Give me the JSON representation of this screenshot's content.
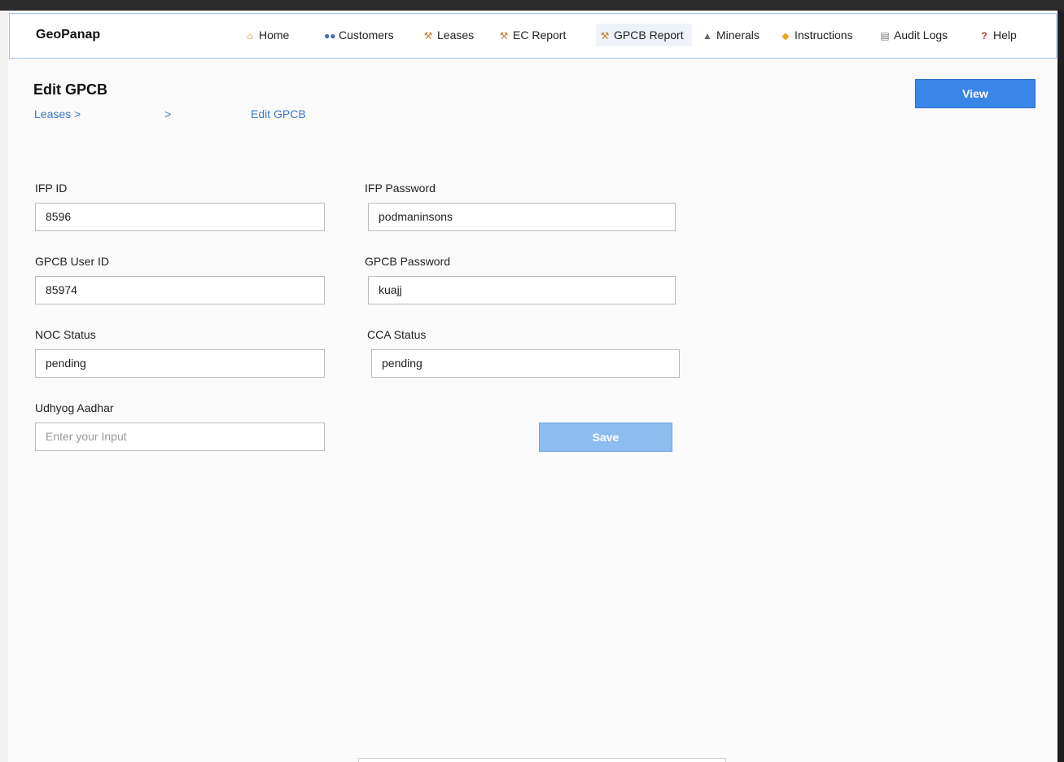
{
  "brand": "GeoPanap",
  "nav": [
    {
      "label": "Home",
      "icon": "home-icon"
    },
    {
      "label": "Customers",
      "icon": "users-icon"
    },
    {
      "label": "Leases",
      "icon": "crane-icon"
    },
    {
      "label": "EC Report",
      "icon": "crane-icon"
    },
    {
      "label": "GPCB Report",
      "icon": "crane-icon"
    },
    {
      "label": "Minerals",
      "icon": "rock-icon"
    },
    {
      "label": "Instructions",
      "icon": "handshake-icon"
    },
    {
      "label": "Audit Logs",
      "icon": "clipboard-icon"
    },
    {
      "label": "Help",
      "icon": "question-icon"
    }
  ],
  "page": {
    "title": "Edit GPCB",
    "breadcrumb": [
      "Leases >",
      ">",
      "Edit GPCB"
    ],
    "view_label": "View"
  },
  "form": {
    "ifp_id_label": "IFP ID",
    "ifp_id_value": "8596",
    "ifp_password_label": "IFP Password",
    "ifp_password_value": "podmaninsons",
    "gpcb_user_id_label": "GPCB User ID",
    "gpcb_user_id_value": "85974",
    "gpcb_password_label": "GPCB Password",
    "gpcb_password_value": "kuajj",
    "noc_status_label": "NOC Status",
    "noc_status_value": "pending",
    "cca_status_label": "CCA Status",
    "cca_status_value": "pending",
    "udhyog_label": "Udhyog Aadhar",
    "udhyog_placeholder": "Enter your Input",
    "save_label": "Save"
  },
  "colors": {
    "primary": "#3a86e8",
    "save_disabled": "#8dbcf0",
    "link": "#3a78c4"
  }
}
